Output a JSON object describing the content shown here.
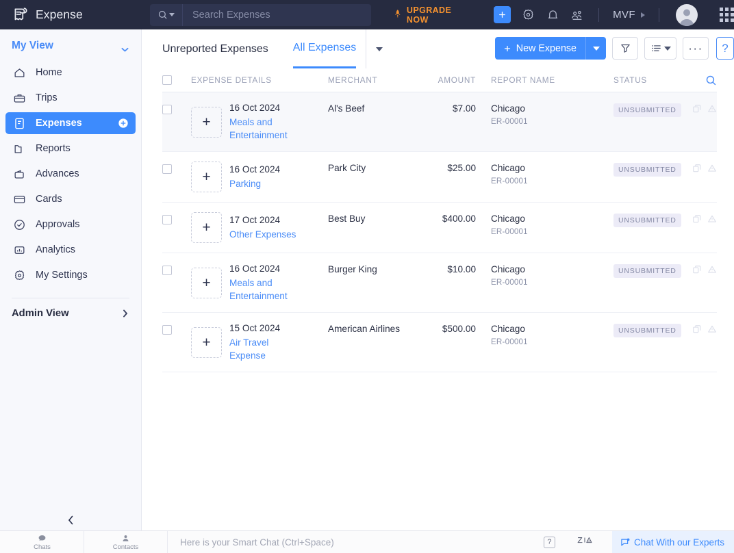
{
  "header": {
    "brand": "Expense",
    "brand_icon": "receipt-icon",
    "search_placeholder": "Search Expenses",
    "search_value": "",
    "upgrade_label": "UPGRADE NOW",
    "upgrade_icon": "rocket-alert-icon",
    "add_icon": "plus-icon",
    "settings_icon": "gear-icon",
    "notifications_icon": "bell-icon",
    "users_icon": "people-icon",
    "org_name": "MVF",
    "org_caret_icon": "caret-right-icon",
    "avatar_icon": "user-avatar",
    "apps_icon": "grid-apps-icon"
  },
  "sidebar": {
    "my_view_label": "My View",
    "my_view_chevron": "chevron-down-icon",
    "items": [
      {
        "label": "Home",
        "icon": "home-icon",
        "active": false
      },
      {
        "label": "Trips",
        "icon": "briefcase-icon",
        "active": false
      },
      {
        "label": "Expenses",
        "icon": "receipt-doc-icon",
        "active": true
      },
      {
        "label": "Reports",
        "icon": "folder-icon",
        "active": false
      },
      {
        "label": "Advances",
        "icon": "wallet-icon",
        "active": false
      },
      {
        "label": "Cards",
        "icon": "credit-card-icon",
        "active": false
      },
      {
        "label": "Approvals",
        "icon": "check-circle-icon",
        "active": false
      },
      {
        "label": "Analytics",
        "icon": "chart-icon",
        "active": false
      },
      {
        "label": "My Settings",
        "icon": "gear-icon",
        "active": false
      }
    ],
    "expenses_add_icon": "plus-circle-icon",
    "admin_view_label": "Admin View",
    "admin_view_chevron": "chevron-right-icon",
    "collapse_icon": "chevron-left-icon"
  },
  "main": {
    "tabs": [
      {
        "label": "Unreported Expenses",
        "active": false
      },
      {
        "label": "All Expenses",
        "active": true
      }
    ],
    "tab_caret_icon": "caret-down-icon",
    "actions": {
      "new_expense_label": "New Expense",
      "new_expense_plus": "plus-icon",
      "new_expense_caret": "caret-down-icon",
      "filter_icon": "funnel-icon",
      "view_icon": "list-view-icon",
      "view_caret": "caret-down-icon",
      "more_label": "···",
      "more_icon": "ellipsis-icon",
      "help_label": "?",
      "help_icon": "question-mark-icon"
    },
    "table": {
      "columns": [
        "EXPENSE DETAILS",
        "MERCHANT",
        "AMOUNT",
        "REPORT NAME",
        "STATUS"
      ],
      "search_icon": "search-icon",
      "rows": [
        {
          "date": "16 Oct 2024",
          "category": "Meals and Entertainment",
          "merchant": "Al's Beef",
          "amount": "$7.00",
          "report_name": "Chicago",
          "report_id": "ER-00001",
          "status": "UNSUBMITTED",
          "receipt_placeholder": "+",
          "highlighted": true
        },
        {
          "date": "16 Oct 2024",
          "category": "Parking",
          "merchant": "Park City",
          "amount": "$25.00",
          "report_name": "Chicago",
          "report_id": "ER-00001",
          "status": "UNSUBMITTED",
          "receipt_placeholder": "+",
          "highlighted": false
        },
        {
          "date": "17 Oct 2024",
          "category": "Other Expenses",
          "merchant": "Best Buy",
          "amount": "$400.00",
          "report_name": "Chicago",
          "report_id": "ER-00001",
          "status": "UNSUBMITTED",
          "receipt_placeholder": "+",
          "highlighted": false
        },
        {
          "date": "16 Oct 2024",
          "category": "Meals and Entertainment",
          "merchant": "Burger King",
          "amount": "$10.00",
          "report_name": "Chicago",
          "report_id": "ER-00001",
          "status": "UNSUBMITTED",
          "receipt_placeholder": "+",
          "highlighted": false
        },
        {
          "date": "15 Oct 2024",
          "category": "Air Travel Expense",
          "merchant": "American Airlines",
          "amount": "$500.00",
          "report_name": "Chicago",
          "report_id": "ER-00001",
          "status": "UNSUBMITTED",
          "receipt_placeholder": "+",
          "highlighted": false
        }
      ],
      "row_icons": [
        "duplicate-icon",
        "warning-icon"
      ]
    }
  },
  "bottombar": {
    "chats_label": "Chats",
    "chats_icon": "chat-bubble-icon",
    "contacts_label": "Contacts",
    "contacts_icon": "person-icon",
    "smartchat_placeholder": "Here is your Smart Chat (Ctrl+Space)",
    "help_label": "?",
    "zia_label": "Zia",
    "zia_icon": "zia-assistant-icon",
    "experts_label": "Chat With our Experts",
    "experts_icon": "chat-support-icon"
  },
  "colors": {
    "accent_blue": "#3d8bfd",
    "header_navy": "#262b40",
    "upgrade_orange": "#f5922f",
    "badge_bg": "#ecebf7",
    "sidebar_bg": "#f7f8fc"
  }
}
